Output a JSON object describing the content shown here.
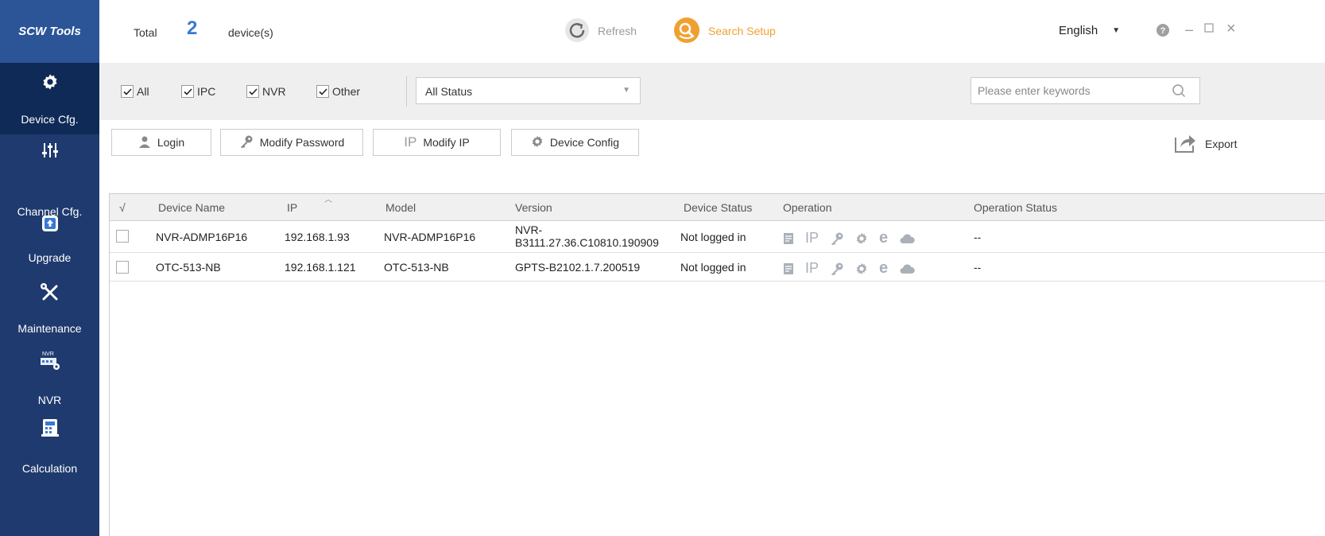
{
  "brand": "SCW Tools",
  "sidebar": {
    "items": [
      {
        "label": "Device Cfg.",
        "icon": "gear-icon",
        "active": true
      },
      {
        "label": "Channel Cfg.",
        "icon": "sliders-icon"
      },
      {
        "label": "Upgrade",
        "icon": "upgrade-icon"
      },
      {
        "label": "Maintenance",
        "icon": "tools-icon"
      },
      {
        "label": "NVR",
        "icon": "nvr-icon",
        "icon_text": "NVR"
      },
      {
        "label": "Calculation",
        "icon": "calculator-icon"
      }
    ]
  },
  "header": {
    "total_label": "Total",
    "total_count": "2",
    "total_unit": "device(s)",
    "refresh_label": "Refresh",
    "search_setup_label": "Search Setup",
    "language": "English"
  },
  "filters": {
    "checkboxes": [
      {
        "label": "All",
        "checked": true
      },
      {
        "label": "IPC",
        "checked": true
      },
      {
        "label": "NVR",
        "checked": true
      },
      {
        "label": "Other",
        "checked": true
      }
    ],
    "status_value": "All Status",
    "search_placeholder": "Please enter keywords"
  },
  "toolbar": {
    "login": "Login",
    "modify_password": "Modify Password",
    "modify_ip_icon_text": "IP",
    "modify_ip": "Modify IP",
    "device_config": "Device Config",
    "export": "Export"
  },
  "table": {
    "columns": [
      "√",
      "Device Name",
      "IP",
      "Model",
      "Version",
      "Device Status",
      "Operation",
      "Operation Status"
    ],
    "rows": [
      {
        "name": "NVR-ADMP16P16",
        "ip": "192.168.1.93",
        "model": "NVR-ADMP16P16",
        "version_line1": "NVR-",
        "version_line2": "B3111.27.36.C10810.190909",
        "status": "Not logged in",
        "op_status": "--"
      },
      {
        "name": "OTC-513-NB",
        "ip": "192.168.1.121",
        "model": "OTC-513-NB",
        "version": "GPTS-B2102.1.7.200519",
        "status": "Not logged in",
        "op_status": "--"
      }
    ],
    "op_ip_text": "IP",
    "op_ie_text": "e"
  },
  "colors": {
    "sidebar": "#1f3a6e",
    "brand_bg": "#2b5597",
    "accent_blue": "#3a78d4",
    "accent_orange": "#f0a030"
  }
}
